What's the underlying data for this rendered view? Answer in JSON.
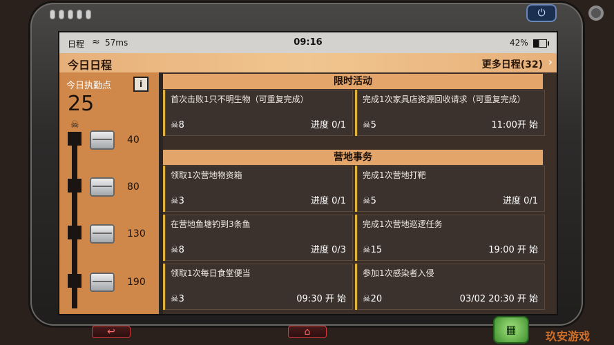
{
  "device": {
    "power_icon": "power-icon"
  },
  "status": {
    "left_label": "日程",
    "ping": "57ms",
    "time": "09:16",
    "battery": "42%"
  },
  "header": {
    "title": "今日日程",
    "more": "更多日程(32)"
  },
  "left": {
    "label": "今日执勤点",
    "info_icon": "i",
    "points": "25",
    "milestones": [
      "40",
      "80",
      "130",
      "190"
    ]
  },
  "sections": [
    {
      "title": "限时活动",
      "cards": [
        {
          "title": "首次击败1只不明生物（可重复完成）",
          "points": "8",
          "status": "进度 0/1"
        },
        {
          "title": "完成1次家具店资源回收请求（可重复完成）",
          "points": "5",
          "status": "11:00开 始"
        }
      ]
    },
    {
      "title": "营地事务",
      "cards": [
        {
          "title": "领取1次营地物资箱",
          "points": "3",
          "status": "进度 0/1"
        },
        {
          "title": "完成1次营地打靶",
          "points": "5",
          "status": "进度 0/1"
        },
        {
          "title": "在营地鱼塘钓到3条鱼",
          "points": "8",
          "status": "进度 0/3"
        },
        {
          "title": "完成1次营地巡逻任务",
          "points": "15",
          "status": "19:00 开 始"
        },
        {
          "title": "领取1次每日食堂便当",
          "points": "3",
          "status": "09:30 开 始"
        },
        {
          "title": "参加1次感染者入侵",
          "points": "20",
          "status": "03/02 20:30 开 始"
        }
      ]
    }
  ],
  "watermark": "玖安游戏"
}
